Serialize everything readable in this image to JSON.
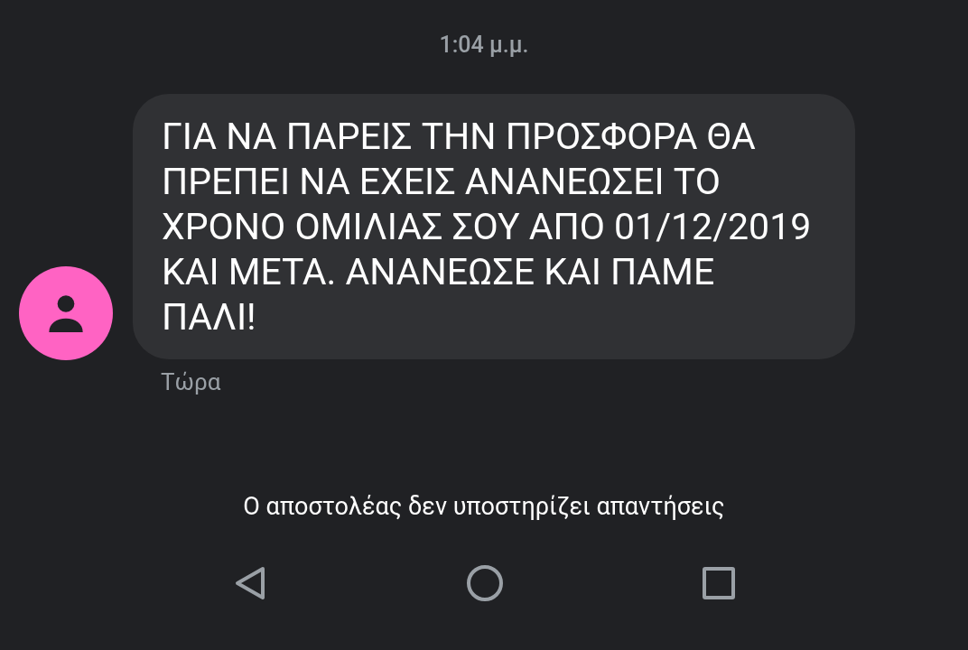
{
  "timestamp": "1:04 μ.μ.",
  "message": {
    "text": "ΓΙΑ ΝΑ ΠΑΡΕΙΣ ΤΗΝ ΠΡΟΣΦΟΡΑ ΘΑ ΠΡΕΠΕΙ ΝΑ ΕΧΕΙΣ ΑΝΑΝΕΩΣΕΙ ΤΟ ΧΡΟΝΟ ΟΜΙΛΙΑΣ ΣΟΥ ΑΠΟ 01/12/2019 ΚΑΙ ΜΕΤΑ. ΑΝΑΝΕΩΣΕ ΚΑΙ ΠΑΜΕ ΠΑΛΙ!",
    "time": "Τώρα"
  },
  "notice": "Ο αποστολέας δεν υποστηρίζει απαντήσεις"
}
